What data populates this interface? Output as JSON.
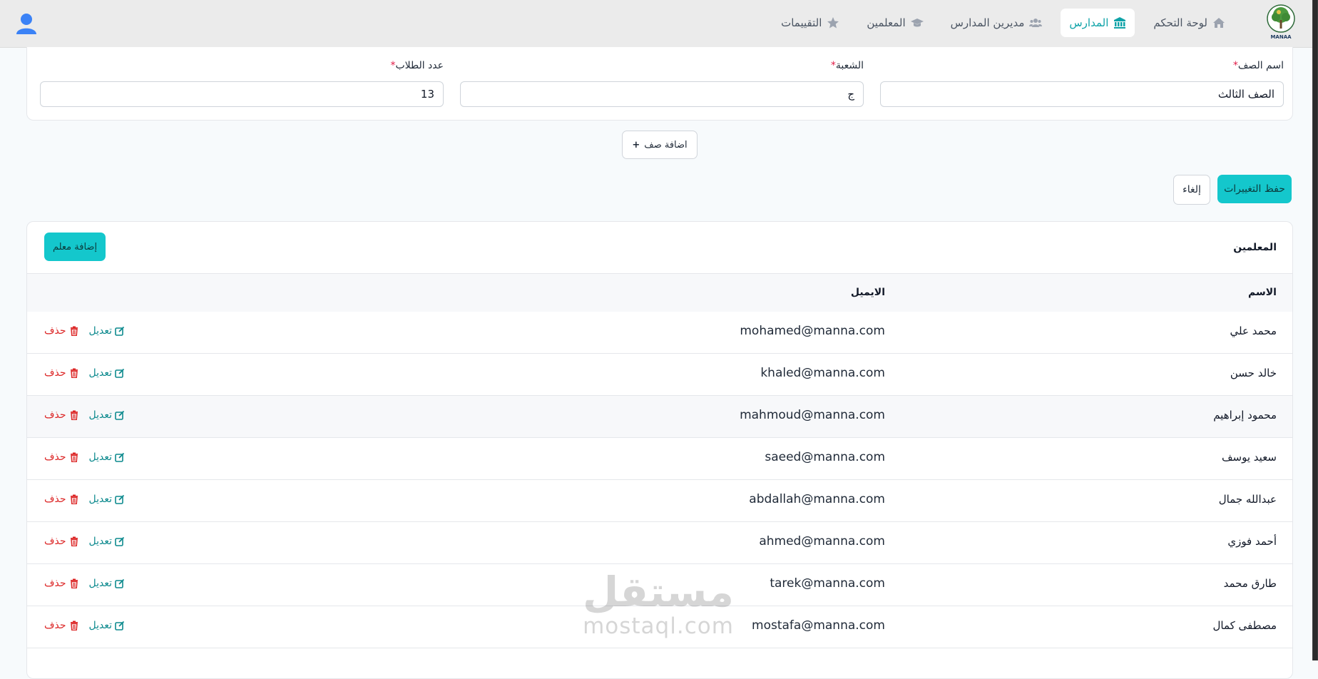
{
  "nav": {
    "items": [
      {
        "label": "لوحة التحكم",
        "icon": "home-icon"
      },
      {
        "label": "المدارس",
        "icon": "school-icon",
        "active": true
      },
      {
        "label": "مديرين المدارس",
        "icon": "users-icon"
      },
      {
        "label": "المعلمين",
        "icon": "graduation-cap-icon"
      },
      {
        "label": "التقييمات",
        "icon": "star-icon"
      }
    ],
    "logo_text": "MANAA"
  },
  "form": {
    "class_name_label": "اسم الصف",
    "class_name_value": "الصف الثالث",
    "section_label": "الشعبة",
    "section_value": "ج",
    "students_label": "عدد الطلاب",
    "students_value": "13",
    "required_mark": "*",
    "add_row_label": "اضافة صف",
    "add_row_icon": "+"
  },
  "actions": {
    "save_label": "حفظ التغييرات",
    "cancel_label": "إلغاء"
  },
  "teachers": {
    "title": "المعلمين",
    "add_label": "إضافة معلم",
    "columns": {
      "name": "الاسم",
      "email": "الايميل"
    },
    "edit_label": "تعديل",
    "delete_label": "حذف",
    "rows": [
      {
        "name": "محمد علي",
        "email": "mohamed@manna.com"
      },
      {
        "name": "خالد حسن",
        "email": "khaled@manna.com"
      },
      {
        "name": "محمود إبراهيم",
        "email": "mahmoud@manna.com"
      },
      {
        "name": "سعيد يوسف",
        "email": "saeed@manna.com"
      },
      {
        "name": "عبدالله جمال",
        "email": "abdallah@manna.com"
      },
      {
        "name": "أحمد فوزي",
        "email": "ahmed@manna.com"
      },
      {
        "name": "طارق محمد",
        "email": "tarek@manna.com"
      },
      {
        "name": "مصطفى كمال",
        "email": "mostafa@manna.com"
      }
    ]
  },
  "watermark": {
    "arabic": "مستقل",
    "latin": "mostaql.com"
  },
  "colors": {
    "accent": "#14c7cc",
    "active_nav": "#0fa3a8",
    "delete": "#dc2626",
    "required": "#e11d48"
  }
}
